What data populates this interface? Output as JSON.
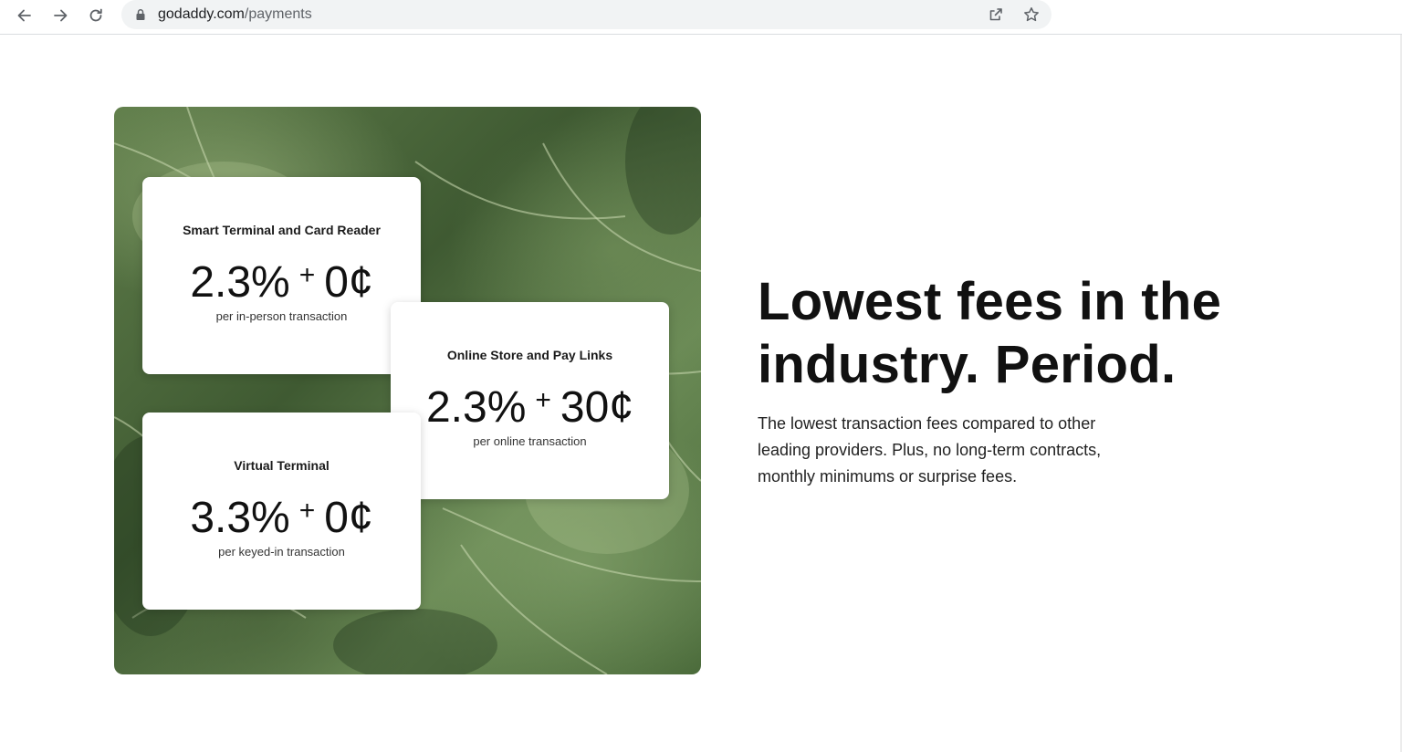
{
  "browser": {
    "url_domain": "godaddy.com",
    "url_path": "/payments",
    "icons": [
      "back-arrow-icon",
      "forward-arrow-icon",
      "reload-icon",
      "lock-icon",
      "share-icon",
      "star-icon"
    ]
  },
  "hero": {
    "cards": [
      {
        "title": "Smart Terminal and Card Reader",
        "percent": "2.3%",
        "plus": "+",
        "fixed": "0¢",
        "note": "per in-person transaction"
      },
      {
        "title": "Online Store and Pay Links",
        "percent": "2.3%",
        "plus": "+",
        "fixed": "30¢",
        "note": "per online transaction"
      },
      {
        "title": "Virtual Terminal",
        "percent": "3.3%",
        "plus": "+",
        "fixed": "0¢",
        "note": "per keyed-in transaction"
      }
    ]
  },
  "content": {
    "headline": "Lowest fees in the industry. Period.",
    "body": "The lowest transaction fees compared to other leading providers. Plus, no long-term contracts, monthly minimums or surprise fees."
  },
  "colors": {
    "leaf_green": "#4a6a3a",
    "card_bg": "#ffffff",
    "text": "#111111"
  }
}
